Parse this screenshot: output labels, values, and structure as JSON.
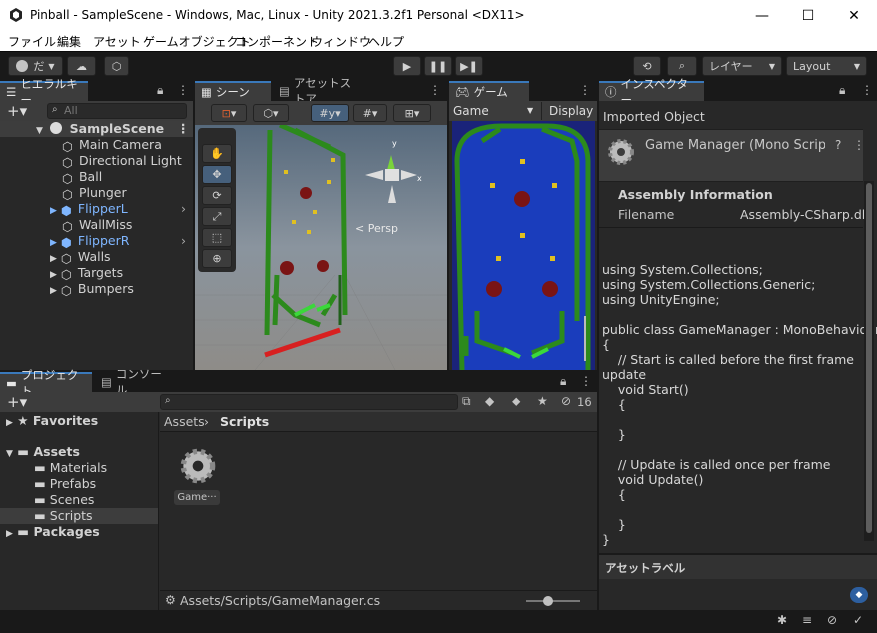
{
  "window": {
    "title": "Pinball - SampleScene - Windows, Mac, Linux - Unity 2021.3.2f1 Personal <DX11>",
    "min": "—",
    "max": "☐",
    "close": "✕"
  },
  "menu": [
    "ファイル",
    "編集",
    "アセット",
    "ゲームオブジェクト",
    "コンポーネント",
    "ウィンドウ",
    "ヘルプ"
  ],
  "toolbar": {
    "account": "だ",
    "layers": "レイヤー",
    "layout": "Layout"
  },
  "hierarchy": {
    "tab": "ヒエラルキー",
    "search_placeholder": "All",
    "scene": "SampleScene",
    "items": [
      "Main Camera",
      "Directional Light",
      "Ball",
      "Plunger",
      "FlipperL",
      "WallMiss",
      "FlipperR",
      "Walls",
      "Targets",
      "Bumpers"
    ]
  },
  "scene": {
    "tab": "シーン",
    "persp": "Persp",
    "axis_y": "y",
    "axis_x": "x"
  },
  "assetstore": {
    "tab": "アセットストア"
  },
  "game": {
    "tab": "ゲーム",
    "display_select": "Game",
    "display": "Display"
  },
  "inspector": {
    "tab": "インスペクター",
    "imported": "Imported Object",
    "script_name": "Game Manager (Mono Script",
    "assembly_header": "Assembly Information",
    "filename_label": "Filename",
    "filename_value": "Assembly-CSharp.dl",
    "code": [
      "using System.Collections;",
      "using System.Collections.Generic;",
      "using UnityEngine;",
      "",
      "public class GameManager : MonoBehaviour",
      "{",
      "    // Start is called before the first frame",
      "update",
      "    void Start()",
      "    {",
      "",
      "    }",
      "",
      "    // Update is called once per frame",
      "    void Update()",
      "    {",
      "",
      "    }",
      "}"
    ],
    "asset_labels": "アセットラベル"
  },
  "project": {
    "tab": "プロジェクト",
    "console_tab": "コンソール",
    "hidden_count": "16",
    "favorites": "Favorites",
    "assets": "Assets",
    "folders": [
      "Materials",
      "Prefabs",
      "Scenes",
      "Scripts"
    ],
    "packages": "Packages",
    "breadcrumb": [
      "Assets",
      "Scripts"
    ],
    "file": "Game···",
    "status_path": "Assets/Scripts/GameManager.cs"
  }
}
